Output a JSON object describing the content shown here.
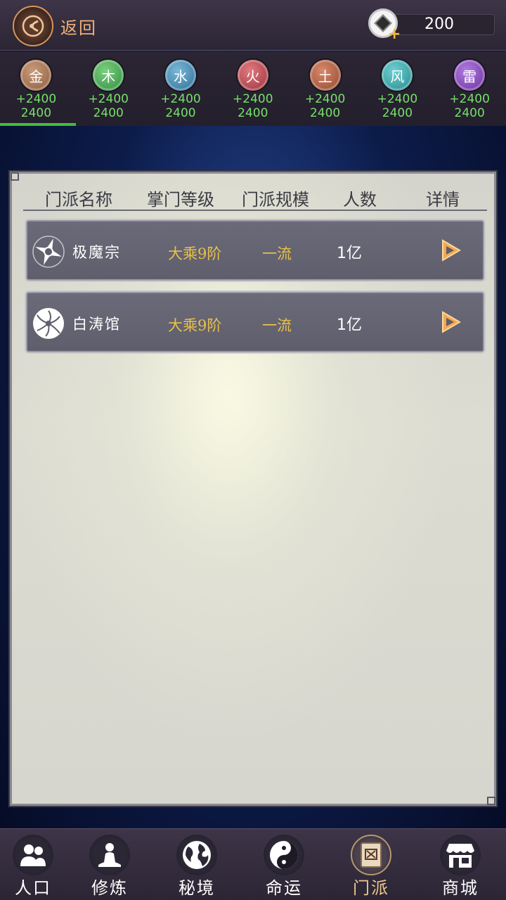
{
  "header": {
    "back_label": "返回",
    "currency_value": "200",
    "currency_icon": "diamond-coin-icon",
    "plus_icon": "plus-icon"
  },
  "elements": [
    {
      "char": "金",
      "bonus": "+2400",
      "value": "2400",
      "color": "#9a6a4a",
      "active": true
    },
    {
      "char": "木",
      "bonus": "+2400",
      "value": "2400",
      "color": "#3e9a52"
    },
    {
      "char": "水",
      "bonus": "+2400",
      "value": "2400",
      "color": "#3a7fa8"
    },
    {
      "char": "火",
      "bonus": "+2400",
      "value": "2400",
      "color": "#b4404a"
    },
    {
      "char": "土",
      "bonus": "+2400",
      "value": "2400",
      "color": "#a5593e"
    },
    {
      "char": "风",
      "bonus": "+2400",
      "value": "2400",
      "color": "#2f9aa0"
    },
    {
      "char": "雷",
      "bonus": "+2400",
      "value": "2400",
      "color": "#7a3fae"
    }
  ],
  "table": {
    "headers": {
      "name": "门派名称",
      "level": "掌门等级",
      "scale": "门派规模",
      "count": "人数",
      "detail": "详情"
    },
    "rows": [
      {
        "name": "极魔宗",
        "level": "大乘9阶",
        "scale": "一流",
        "count": "1亿",
        "icon": "shuriken-emblem-icon"
      },
      {
        "name": "白涛馆",
        "level": "大乘9阶",
        "scale": "一流",
        "count": "1亿",
        "icon": "wave-emblem-icon"
      }
    ]
  },
  "nav": [
    {
      "label": "人口",
      "icon": "people-icon"
    },
    {
      "label": "修炼",
      "icon": "meditation-icon"
    },
    {
      "label": "秘境",
      "icon": "globe-icon"
    },
    {
      "label": "命运",
      "icon": "yin-yang-icon"
    },
    {
      "label": "门派",
      "icon": "sect-book-icon",
      "active": true
    },
    {
      "label": "商城",
      "icon": "shop-icon"
    }
  ]
}
